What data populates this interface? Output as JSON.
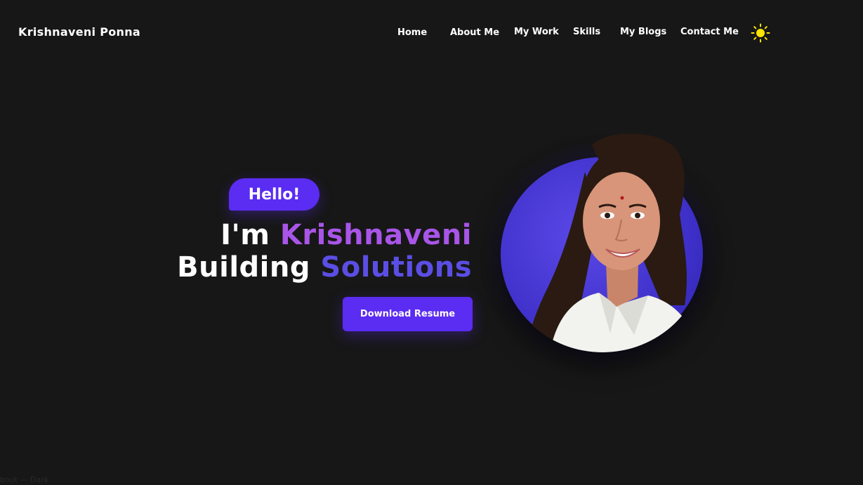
{
  "brand": "Krishnaveni Ponna",
  "nav": {
    "home": "Home",
    "about": "About Me",
    "work": "My Work",
    "skills": "Skills",
    "blogs": "My Blogs",
    "contact": "Contact Me",
    "theme_icon": "sun-icon"
  },
  "hero": {
    "greeting": "Hello!",
    "line1_prefix": "I'm",
    "line1_name": "Krishnaveni",
    "line2_prefix": "Building",
    "line2_word": "Solutions",
    "button": "Download Resume"
  },
  "footer": {
    "text": "bout — Dark"
  },
  "colors": {
    "background": "#171717",
    "accent": "#5b2cf2",
    "name_color": "#a855e8",
    "solutions_color": "#5b4ee4",
    "sun": "#ffe500"
  }
}
